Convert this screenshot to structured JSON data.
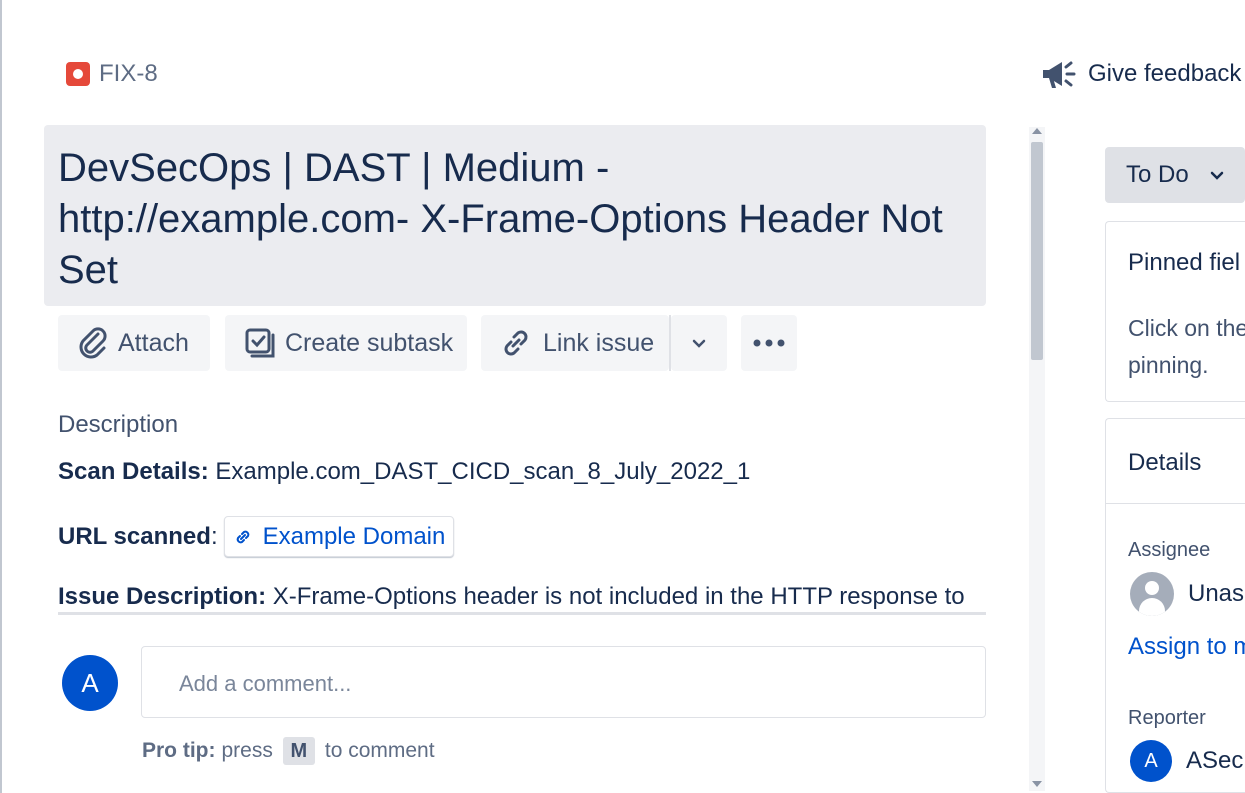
{
  "header": {
    "issue_key": "FIX-8",
    "feedback_label": "Give feedback"
  },
  "issue": {
    "title": "DevSecOps | DAST | Medium - http://example.com- X-Frame-Options Header Not Set"
  },
  "actions": {
    "attach": "Attach",
    "create_subtask": "Create subtask",
    "link_issue": "Link issue"
  },
  "description": {
    "heading": "Description",
    "scan_details_label": "Scan Details:",
    "scan_details_value": " Example.com_DAST_CICD_scan_8_July_2022_1",
    "url_label": "URL scanned",
    "url_sep": ":",
    "url_link_text": "Example Domain",
    "issue_desc_label": "Issue Description:",
    "issue_desc_value": " X-Frame-Options header is not included in the HTTP response to"
  },
  "comment": {
    "avatar_initial": "A",
    "placeholder": "Add a comment...",
    "protip_label": "Pro tip:",
    "protip_press": "press",
    "protip_key": "M",
    "protip_suffix": "to comment"
  },
  "sidebar": {
    "status": "To Do",
    "pinned_title": "Pinned fiel",
    "pinned_line1": "Click on the",
    "pinned_line2": "pinning.",
    "details_title": "Details",
    "assignee_label": "Assignee",
    "assignee_value": "Unas",
    "assign_to_me": "Assign to m",
    "reporter_label": "Reporter",
    "reporter_initial": "A",
    "reporter_value": "ASec"
  },
  "colors": {
    "bug": "#e5493a",
    "brand_blue": "#0052cc",
    "title_bg": "#ebecf0",
    "button_bg": "#f4f5f7"
  }
}
